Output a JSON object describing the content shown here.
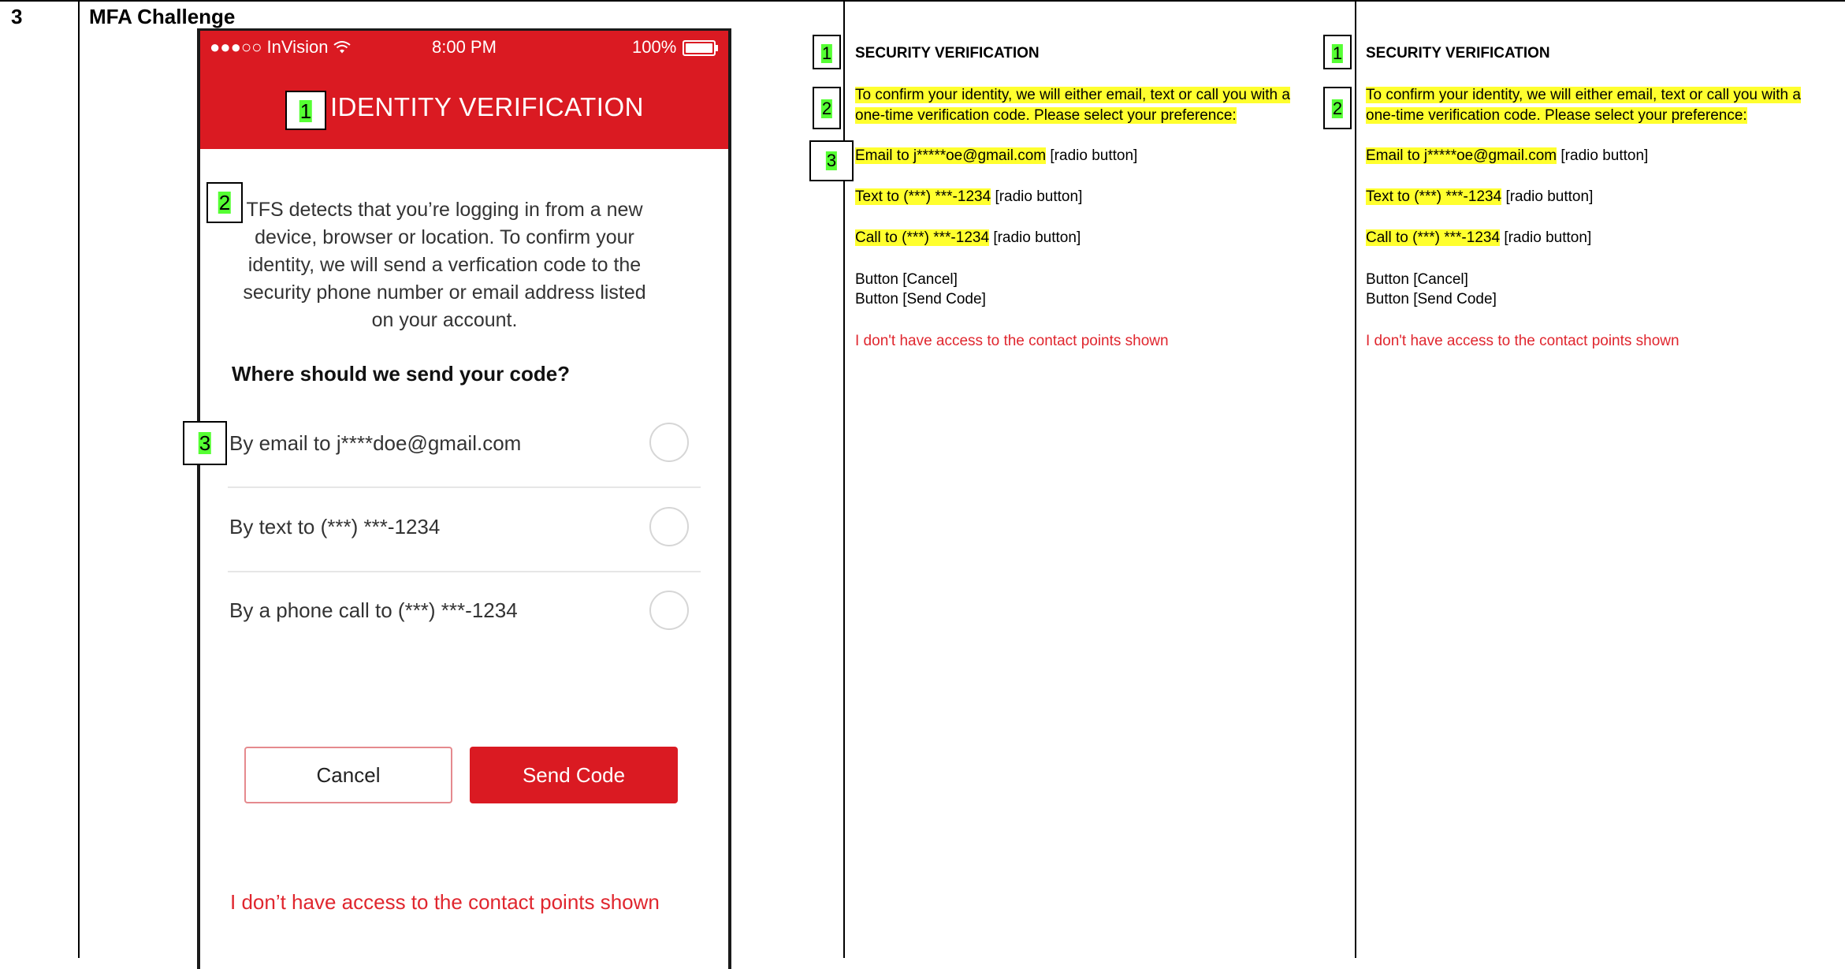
{
  "row": {
    "number": "3",
    "title": "MFA Challenge"
  },
  "phone": {
    "status_bar": {
      "carrier": "●●●○○ InVision",
      "wifi_icon": "wifi-icon",
      "time": "8:00 PM",
      "battery": "100%"
    },
    "header_title": "IDENTITY VERIFICATION",
    "intro_text": "TFS detects that you’re logging in from a new device, browser or location. To confirm your identity, we will send a verfication code to the security phone number or email address listed on your account.",
    "question": "Where should we send your code?",
    "options": [
      {
        "label": "By email to j****doe@gmail.com"
      },
      {
        "label": "By text to (***) ***-1234"
      },
      {
        "label": "By a phone call to (***) ***-1234"
      }
    ],
    "cancel_label": "Cancel",
    "send_label": "Send Code",
    "no_access_link": "I don’t have access to the contact points shown",
    "accent_color": "#da1a22"
  },
  "markers": {
    "one": "1",
    "two": "2",
    "three": "3"
  },
  "spec_columns": [
    {
      "title": "SECURITY VERIFICATION",
      "intro": "To confirm your identity, we will either email, text or call you with a one-time verification code. Please select your preference:",
      "email": "Email to j*****oe@gmail.com",
      "text": "Text to (***) ***-1234",
      "call": "Call to (***) ***-1234",
      "radio_note": "[radio button]",
      "button_cancel": "Button [Cancel]",
      "button_send": "Button [Send Code]",
      "no_access": "I don't have access to the contact points shown"
    },
    {
      "title": "SECURITY VERIFICATION",
      "intro": "To confirm your identity, we will either email, text or call you with a one-time verification code. Please select your preference:",
      "email": "Email to j*****oe@gmail.com",
      "text": "Text to (***) ***-1234",
      "call": "Call to (***) ***-1234",
      "radio_note": "[radio button]",
      "button_cancel": "Button [Cancel]",
      "button_send": "Button [Send Code]",
      "no_access": "I don't have access to the contact points shown"
    }
  ],
  "colors": {
    "highlight_yellow": "#ffff2e",
    "marker_green": "#55ff33",
    "link_red": "#e0262e"
  }
}
